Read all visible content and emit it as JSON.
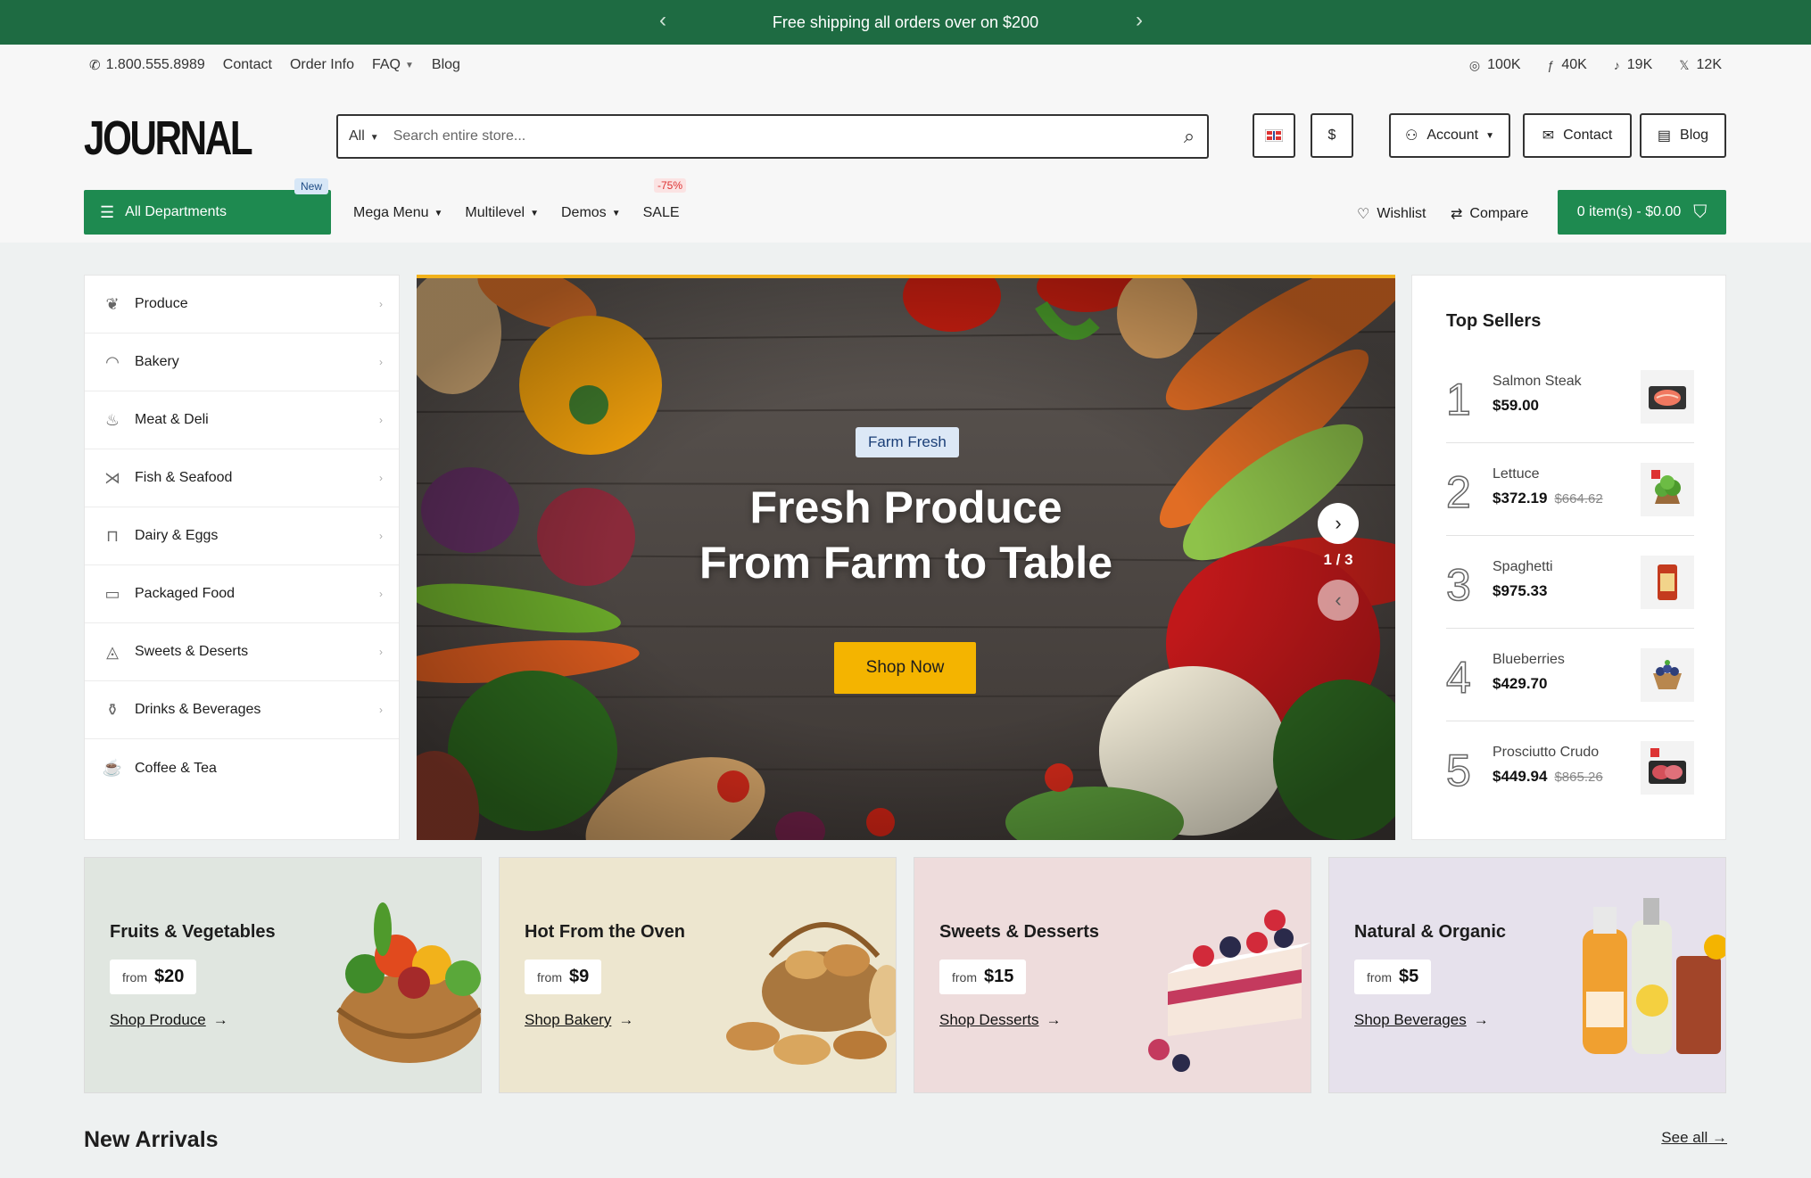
{
  "topbar": {
    "message": "Free shipping all orders over on $200"
  },
  "util": {
    "phone": "1.800.555.8989",
    "links": [
      "Contact",
      "Order Info",
      "FAQ",
      "Blog"
    ]
  },
  "social": [
    {
      "icon": "instagram-icon",
      "count": "100K"
    },
    {
      "icon": "facebook-icon",
      "count": "40K"
    },
    {
      "icon": "tiktok-icon",
      "count": "19K"
    },
    {
      "icon": "x-icon",
      "count": "12K"
    }
  ],
  "logo": "JOURNAL",
  "search": {
    "category": "All",
    "placeholder": "Search entire store..."
  },
  "header_buttons": {
    "currency": "$",
    "account": "Account",
    "contact": "Contact",
    "blog": "Blog"
  },
  "nav": {
    "departments": "All Departments",
    "new_badge": "New",
    "items": [
      "Mega Menu",
      "Multilevel",
      "Demos",
      "SALE"
    ],
    "sale_badge": "-75%",
    "wishlist": "Wishlist",
    "compare": "Compare",
    "cart": "0 item(s) - $0.00"
  },
  "categories": [
    "Produce",
    "Bakery",
    "Meat & Deli",
    "Fish & Seafood",
    "Dairy & Eggs",
    "Packaged Food",
    "Sweets & Deserts",
    "Drinks & Beverages",
    "Coffee & Tea"
  ],
  "hero": {
    "tag": "Farm Fresh",
    "title_line1": "Fresh Produce",
    "title_line2": "From Farm to Table",
    "cta": "Shop Now",
    "pager": "1 / 3"
  },
  "top_sellers": {
    "title": "Top Sellers",
    "items": [
      {
        "rank": "1",
        "name": "Salmon Steak",
        "price": "$59.00",
        "old": ""
      },
      {
        "rank": "2",
        "name": "Lettuce",
        "price": "$372.19",
        "old": "$664.62"
      },
      {
        "rank": "3",
        "name": "Spaghetti",
        "price": "$975.33",
        "old": ""
      },
      {
        "rank": "4",
        "name": "Blueberries",
        "price": "$429.70",
        "old": ""
      },
      {
        "rank": "5",
        "name": "Prosciutto Crudo",
        "price": "$449.94",
        "old": "$865.26"
      }
    ]
  },
  "promos": [
    {
      "title": "Fruits & Vegetables",
      "from": "from",
      "price": "$20",
      "link": "Shop Produce",
      "bg": "#e0e6e0"
    },
    {
      "title": "Hot From the Oven",
      "from": "from",
      "price": "$9",
      "link": "Shop Bakery",
      "bg": "#ede6cf"
    },
    {
      "title": "Sweets & Desserts",
      "from": "from",
      "price": "$15",
      "link": "Shop Desserts",
      "bg": "#eedcdc"
    },
    {
      "title": "Natural & Organic",
      "from": "from",
      "price": "$5",
      "link": "Shop Beverages",
      "bg": "#e6e1ec"
    }
  ],
  "new_arrivals": {
    "title": "New Arrivals",
    "see_all": "See all"
  }
}
